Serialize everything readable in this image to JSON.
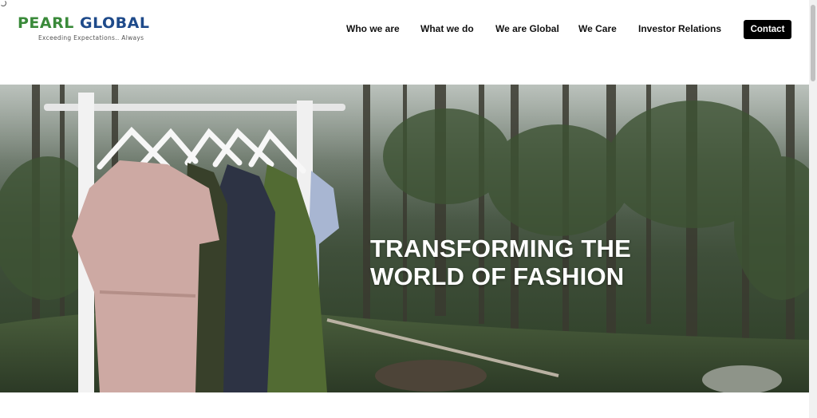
{
  "brand": {
    "name_part1": "PEARL ",
    "name_part2": "GLOBAL",
    "tagline": "Exceeding Expectations.. Always"
  },
  "nav": {
    "items": [
      {
        "label": "Who we are"
      },
      {
        "label": "What we do"
      },
      {
        "label": "We are Global"
      },
      {
        "label": "We Care"
      },
      {
        "label": "Investor Relations"
      }
    ],
    "contact_label": "Contact"
  },
  "hero": {
    "title_line1": "TRANSFORMING THE",
    "title_line2": "WORLD OF FASHION"
  },
  "colors": {
    "brand_green": "#3a8a3a",
    "brand_blue": "#1e4a8a",
    "contact_bg": "#000000"
  }
}
